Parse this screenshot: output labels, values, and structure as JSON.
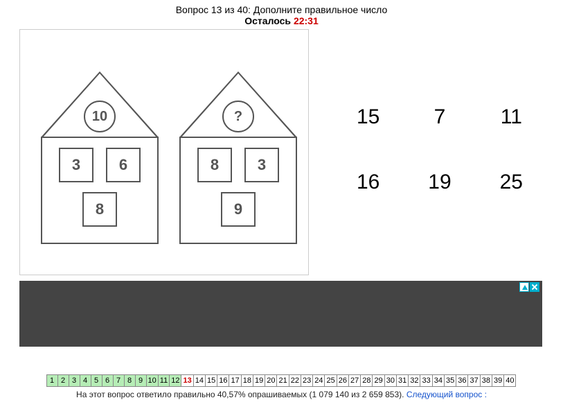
{
  "header": {
    "question_label": "Вопрос 13 из 40: Дополните правильное число",
    "timer_label": "Осталось ",
    "timer_value": "22:31"
  },
  "puzzle": {
    "house1": {
      "top": "10",
      "left": "3",
      "right": "6",
      "bottom": "8"
    },
    "house2": {
      "top": "?",
      "left": "8",
      "right": "3",
      "bottom": "9"
    }
  },
  "answers": {
    "row1": [
      "15",
      "7",
      "11"
    ],
    "row2": [
      "16",
      "19",
      "25"
    ]
  },
  "nav": {
    "total": 40,
    "current": 13,
    "answered_max": 12
  },
  "footer": {
    "stats": "На этот вопрос ответило правильно 40,57% опрашиваемых (1 079 140 из 2 659 853). ",
    "next_label": "Следующий вопрос :"
  }
}
